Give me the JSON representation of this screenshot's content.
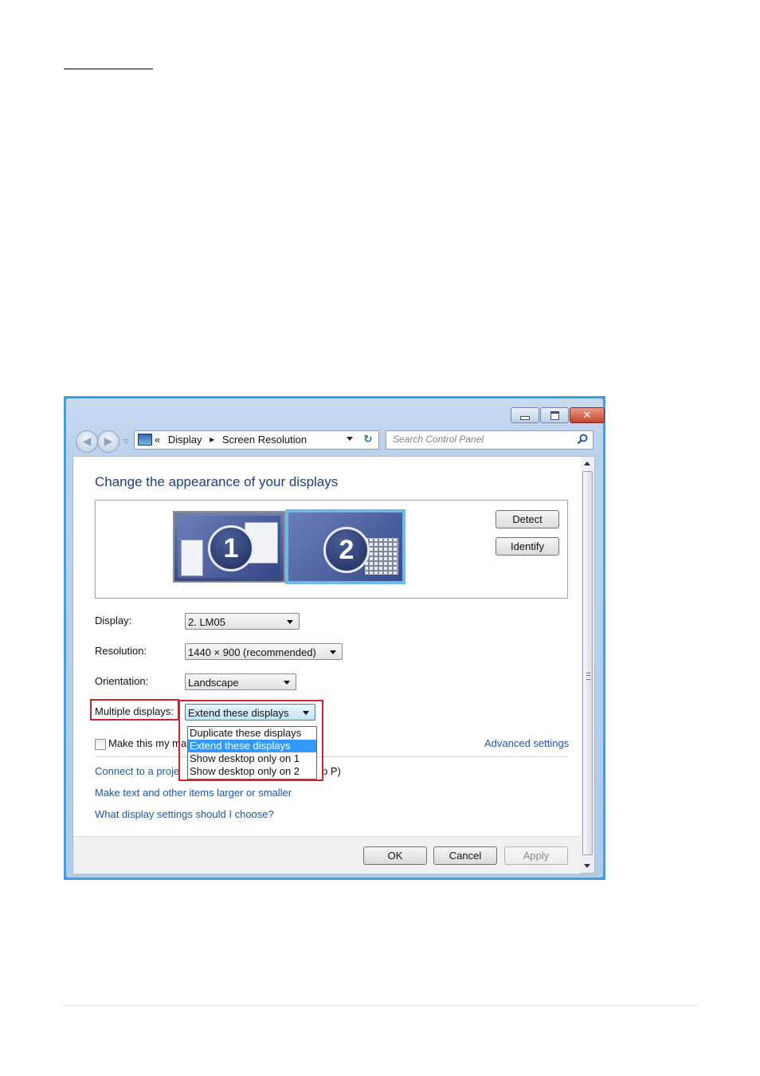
{
  "window": {
    "nav": {
      "breadcrumb_prefix": "«",
      "crumbs": [
        "Display",
        "Screen Resolution"
      ],
      "search_placeholder": "Search Control Panel"
    },
    "page_title": "Change the appearance of your displays",
    "monitors": [
      "1",
      "2"
    ],
    "detect_label": "Detect",
    "identify_label": "Identify",
    "fields": {
      "display": {
        "label": "Display:",
        "value": "2. LM05"
      },
      "resolution": {
        "label": "Resolution:",
        "value": "1440 × 900 (recommended)"
      },
      "orientation": {
        "label": "Orientation:",
        "value": "Landscape"
      },
      "multiple": {
        "label": "Multiple displays:",
        "value": "Extend these displays"
      }
    },
    "dropdown_options": [
      "Duplicate these displays",
      "Extend these displays",
      "Show desktop only on 1",
      "Show desktop only on 2"
    ],
    "checkbox_label_visible": "Make this my ma",
    "advanced_settings": "Advanced settings",
    "links": {
      "projector_visible_start": "Connect to a proje",
      "projector_visible_end": "p P)",
      "larger_text": "Make text and other items larger or smaller",
      "which_settings": "What display settings should I choose?"
    },
    "buttons": {
      "ok": "OK",
      "cancel": "Cancel",
      "apply": "Apply"
    }
  },
  "colors": {
    "highlight_red": "#d0232e",
    "link_blue": "#1c56b8",
    "title_blue": "#1e3d87",
    "selection_blue": "#3399ff"
  }
}
